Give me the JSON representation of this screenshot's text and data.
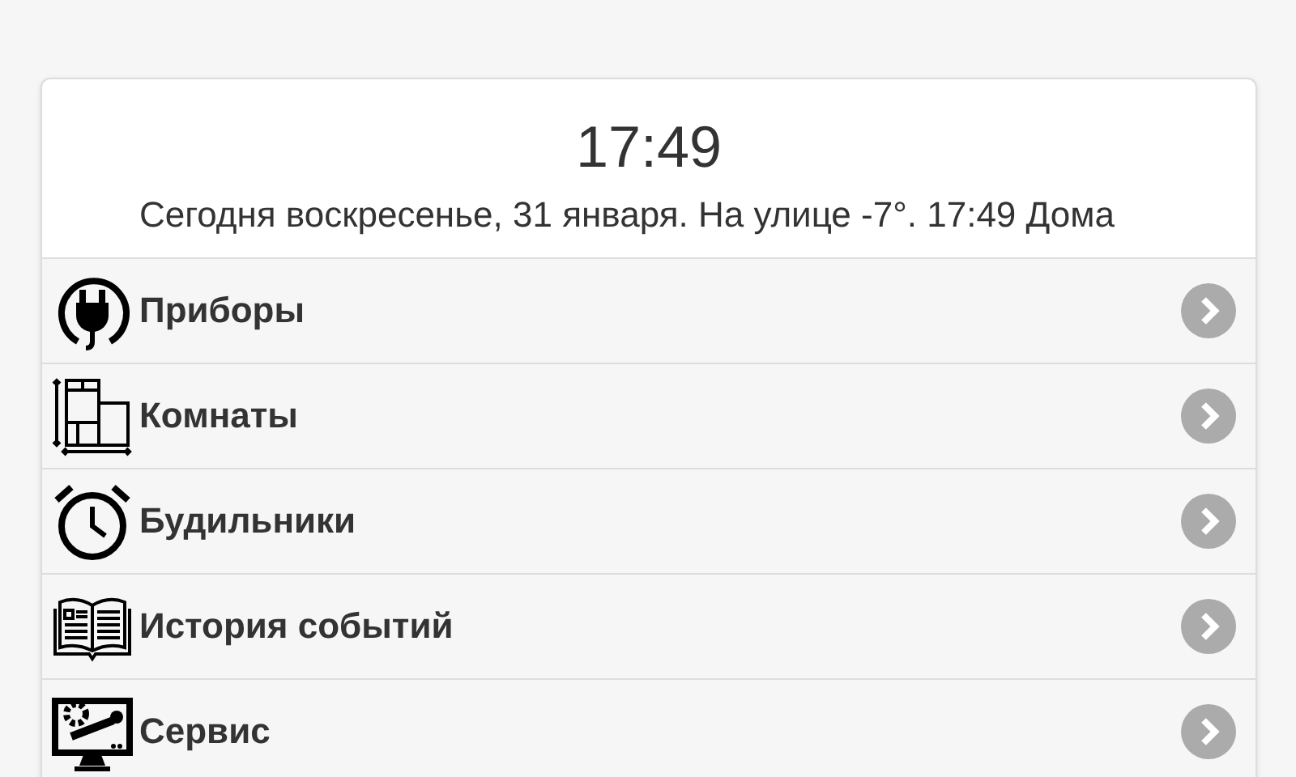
{
  "header": {
    "time": "17:49",
    "ticker": "Сегодня воскресенье, 31 января. На улице -7°. 17:49 Дома"
  },
  "menu": [
    {
      "label": "Приборы",
      "kind": "plug"
    },
    {
      "label": "Комнаты",
      "kind": "rooms"
    },
    {
      "label": "Будильники",
      "kind": "alarm"
    },
    {
      "label": "История событий",
      "kind": "book"
    },
    {
      "label": "Сервис",
      "kind": "service"
    }
  ]
}
